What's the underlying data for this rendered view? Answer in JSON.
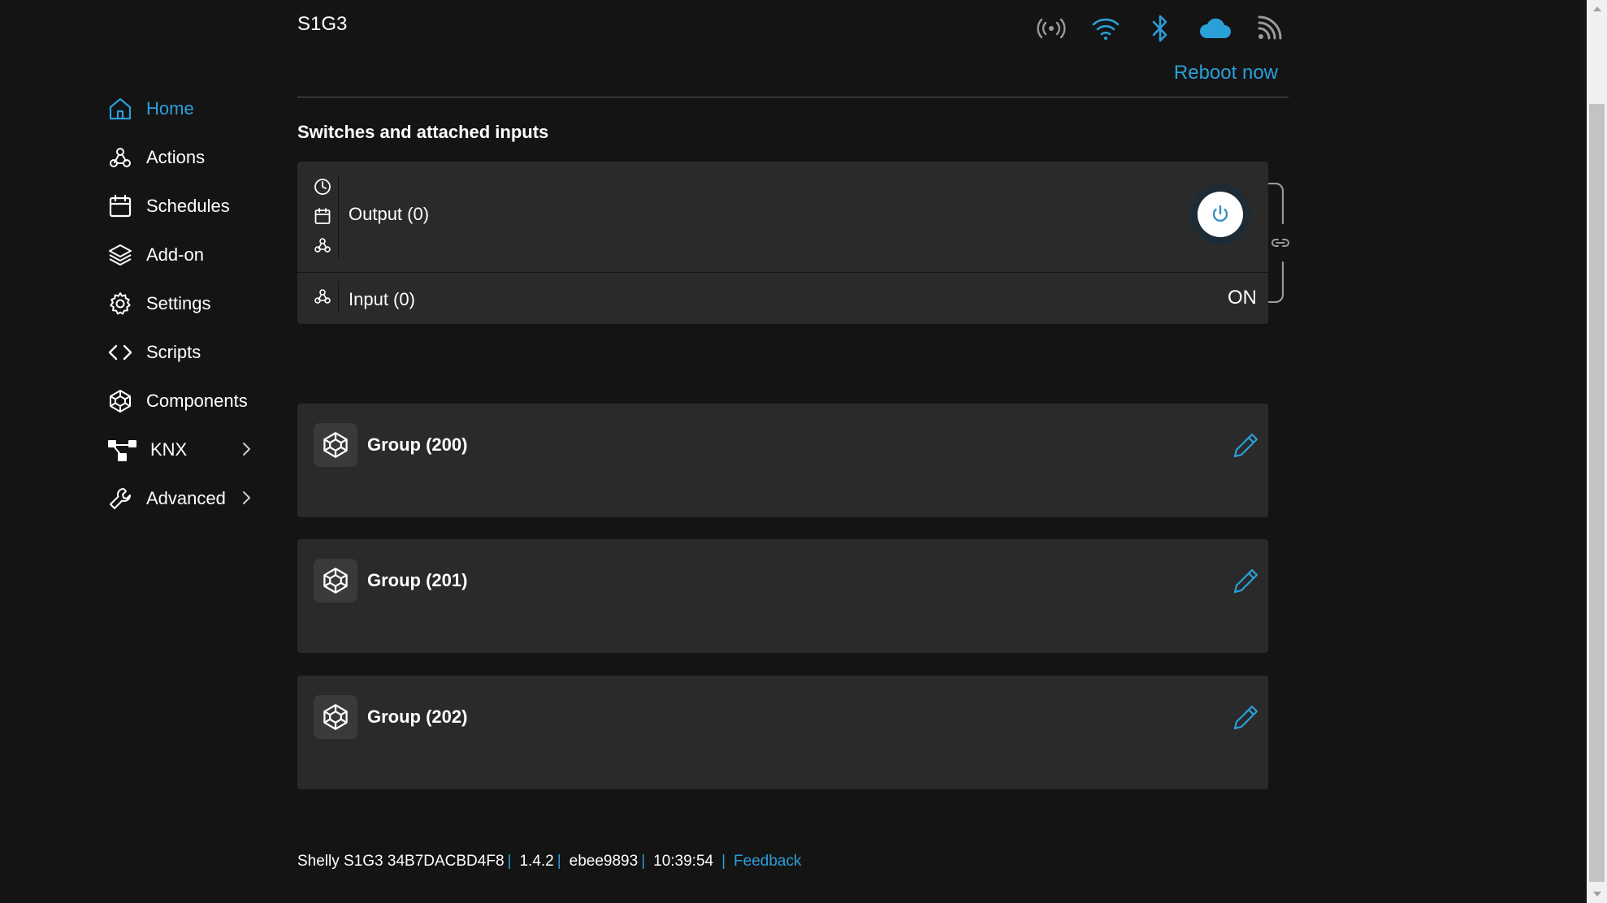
{
  "header": {
    "device_name": "S1G3",
    "reboot_label": "Reboot now",
    "status_icons": [
      "radio-signal-icon",
      "wifi-icon",
      "bluetooth-icon",
      "cloud-icon",
      "rss-icon"
    ]
  },
  "sidebar": {
    "items": [
      {
        "label": "Home",
        "icon": "home-icon",
        "active": true
      },
      {
        "label": "Actions",
        "icon": "webhook-icon"
      },
      {
        "label": "Schedules",
        "icon": "calendar-icon"
      },
      {
        "label": "Add-on",
        "icon": "layers-icon"
      },
      {
        "label": "Settings",
        "icon": "gear-icon"
      },
      {
        "label": "Scripts",
        "icon": "code-icon"
      },
      {
        "label": "Components",
        "icon": "components-icon"
      },
      {
        "label": "KNX",
        "icon": "knx-network-icon",
        "has_submenu": true
      },
      {
        "label": "Advanced",
        "icon": "wrench-icon",
        "has_submenu": true
      }
    ]
  },
  "main": {
    "section_title": "Switches and attached inputs",
    "switch": {
      "output_label": "Output (0)",
      "input_label": "Input (0)",
      "input_state": "ON"
    },
    "groups": [
      {
        "name": "Group (200)"
      },
      {
        "name": "Group (201)"
      },
      {
        "name": "Group (202)"
      }
    ]
  },
  "footer": {
    "device": "Shelly S1G3 34B7DACBD4F8",
    "version": "1.4.2",
    "build": "ebee9893",
    "time": "10:39:54",
    "feedback_label": "Feedback"
  },
  "colors": {
    "accent": "#2a9fd8",
    "background": "#141414",
    "card": "#2a2a2a"
  }
}
